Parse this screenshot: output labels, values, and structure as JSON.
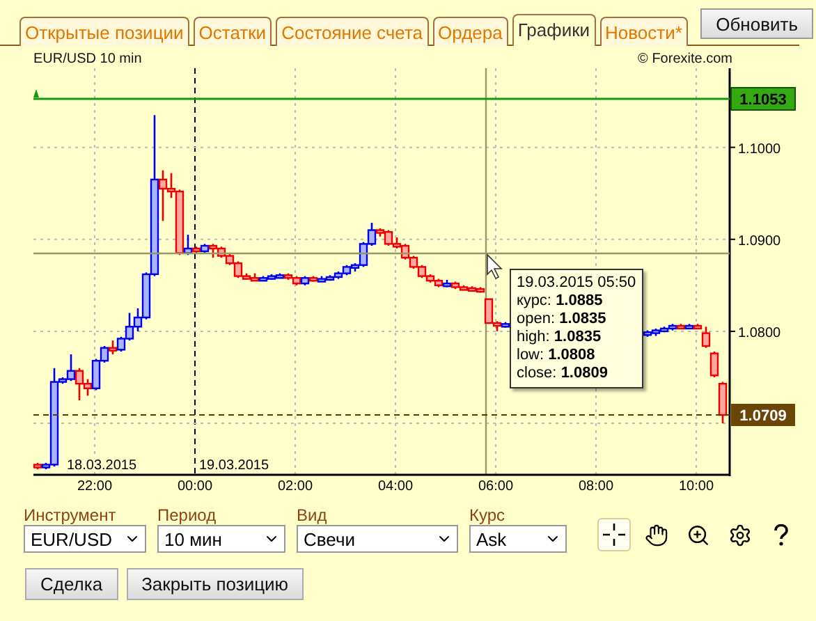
{
  "tabs": [
    {
      "label": "Открытые позиции",
      "selected": false
    },
    {
      "label": "Остатки",
      "selected": false
    },
    {
      "label": "Состояние счета",
      "selected": false
    },
    {
      "label": "Ордера",
      "selected": false
    },
    {
      "label": "Графики",
      "selected": true
    },
    {
      "label": "Новости*",
      "selected": false
    }
  ],
  "refresh_button": "Обновить",
  "chart": {
    "symbol_label": "EUR/USD 10 min",
    "copyright": "© Forexite.com",
    "date_labels": [
      "18.03.2015",
      "19.03.2015"
    ],
    "high_marker": "1.1053",
    "current_price": "1.0709",
    "tooltip": {
      "title": "19.03.2015 05:50",
      "rows": [
        {
          "label": "курс:",
          "value": "1.0885"
        },
        {
          "label": "open:",
          "value": "1.0835"
        },
        {
          "label": "high:",
          "value": "1.0835"
        },
        {
          "label": "low:",
          "value": "1.0808"
        },
        {
          "label": "close:",
          "value": "1.0809"
        }
      ]
    },
    "chart_data": {
      "type": "candlestick",
      "categories": [
        null,
        null,
        null,
        null,
        null,
        null,
        null,
        "22:00",
        null,
        null,
        null,
        null,
        null,
        null,
        null,
        null,
        null,
        null,
        null,
        "00:00",
        null,
        null,
        null,
        null,
        null,
        null,
        null,
        null,
        null,
        null,
        null,
        "02:00",
        null,
        null,
        null,
        null,
        null,
        null,
        null,
        null,
        null,
        null,
        null,
        "04:00",
        null,
        null,
        null,
        null,
        null,
        null,
        null,
        null,
        null,
        null,
        null,
        "06:00",
        null,
        null,
        null,
        null,
        null,
        null,
        null,
        null,
        null,
        null,
        null,
        "08:00",
        null,
        null,
        null,
        null,
        null,
        null,
        null,
        null,
        null,
        null,
        null,
        "10:00",
        null,
        null,
        null
      ],
      "ylim": [
        1.0644,
        1.1086
      ],
      "grid": true,
      "yticks": [
        {
          "value": 1.1,
          "label": "1.1000"
        },
        {
          "value": 1.09,
          "label": "1.0900"
        },
        {
          "value": 1.08,
          "label": "1.0800"
        }
      ],
      "ohlc": [
        [
          1.0655,
          1.0657,
          1.065,
          1.0652
        ],
        [
          1.0652,
          1.0657,
          1.065,
          1.0655
        ],
        [
          1.0655,
          1.076,
          1.0653,
          1.0745
        ],
        [
          1.0745,
          1.075,
          1.0743,
          1.0748
        ],
        [
          1.0748,
          1.0775,
          1.0746,
          1.0757
        ],
        [
          1.0757,
          1.076,
          1.0725,
          1.0743
        ],
        [
          1.0743,
          1.0748,
          1.073,
          1.0738
        ],
        [
          1.0738,
          1.077,
          1.0736,
          1.0768
        ],
        [
          1.0768,
          1.0784,
          1.0766,
          1.0782
        ],
        [
          1.0782,
          1.079,
          1.0775,
          1.078
        ],
        [
          1.078,
          1.0794,
          1.0778,
          1.0792
        ],
        [
          1.0792,
          1.082,
          1.079,
          1.0805
        ],
        [
          1.0805,
          1.0825,
          1.08,
          1.0815
        ],
        [
          1.0815,
          1.0864,
          1.0813,
          1.0862
        ],
        [
          1.0862,
          1.1035,
          1.086,
          1.0965
        ],
        [
          1.0965,
          1.0975,
          1.092,
          1.0955
        ],
        [
          1.0955,
          1.0972,
          1.0945,
          1.0952
        ],
        [
          1.0952,
          1.0954,
          1.0883,
          1.0885
        ],
        [
          1.0885,
          1.0905,
          1.0883,
          1.089
        ],
        [
          1.089,
          1.0892,
          1.0885,
          1.0887
        ],
        [
          1.0887,
          1.0895,
          1.0885,
          1.0893
        ],
        [
          1.0893,
          1.0895,
          1.088,
          1.089
        ],
        [
          1.089,
          1.0892,
          1.088,
          1.0882
        ],
        [
          1.0882,
          1.0884,
          1.0872,
          1.0874
        ],
        [
          1.0874,
          1.0876,
          1.0858,
          1.086
        ],
        [
          1.086,
          1.0863,
          1.0856,
          1.0858
        ],
        [
          1.0858,
          1.0863,
          1.0855,
          1.0857
        ],
        [
          1.0857,
          1.086,
          1.0855,
          1.0858
        ],
        [
          1.0858,
          1.0862,
          1.0856,
          1.086
        ],
        [
          1.086,
          1.0863,
          1.0858,
          1.0861
        ],
        [
          1.0861,
          1.0863,
          1.0856,
          1.0858
        ],
        [
          1.0858,
          1.086,
          1.085,
          1.0852
        ],
        [
          1.0852,
          1.086,
          1.085,
          1.0858
        ],
        [
          1.0858,
          1.086,
          1.0854,
          1.0856
        ],
        [
          1.0856,
          1.086,
          1.0854,
          1.0857
        ],
        [
          1.0857,
          1.0861,
          1.0855,
          1.0859
        ],
        [
          1.0859,
          1.0865,
          1.0857,
          1.0863
        ],
        [
          1.0863,
          1.0872,
          1.0861,
          1.087
        ],
        [
          1.087,
          1.0874,
          1.0865,
          1.0872
        ],
        [
          1.0872,
          1.0897,
          1.087,
          1.0895
        ],
        [
          1.0895,
          1.0918,
          1.0893,
          1.091
        ],
        [
          1.091,
          1.0912,
          1.0903,
          1.0908
        ],
        [
          1.0908,
          1.091,
          1.0893,
          1.0895
        ],
        [
          1.0895,
          1.0902,
          1.089,
          1.0893
        ],
        [
          1.0893,
          1.0895,
          1.0878,
          1.088
        ],
        [
          1.088,
          1.0882,
          1.0868,
          1.087
        ],
        [
          1.087,
          1.0872,
          1.0858,
          1.086
        ],
        [
          1.086,
          1.0862,
          1.0853,
          1.0855
        ],
        [
          1.0855,
          1.0857,
          1.0848,
          1.085
        ],
        [
          1.085,
          1.0856,
          1.0848,
          1.0852
        ],
        [
          1.0852,
          1.0854,
          1.0846,
          1.0848
        ],
        [
          1.0848,
          1.085,
          1.0845,
          1.0847
        ],
        [
          1.0847,
          1.0849,
          1.0844,
          1.0846
        ],
        [
          1.0846,
          1.0848,
          1.0842,
          1.0844
        ],
        [
          1.0835,
          1.0835,
          1.0808,
          1.0809
        ],
        [
          1.0809,
          1.0811,
          1.08,
          1.0806
        ],
        [
          1.0806,
          1.081,
          1.0804,
          1.0808
        ],
        null,
        null,
        null,
        null,
        null,
        null,
        null,
        null,
        null,
        null,
        null,
        null,
        null,
        null,
        null,
        null,
        [
          1.0796,
          1.0801,
          1.0794,
          1.0799
        ],
        [
          1.0799,
          1.0803,
          1.0795,
          1.0801
        ],
        [
          1.0801,
          1.0805,
          1.0799,
          1.0803
        ],
        [
          1.0803,
          1.0808,
          1.0801,
          1.0806
        ],
        [
          1.0806,
          1.0808,
          1.0803,
          1.0805
        ],
        [
          1.0805,
          1.0808,
          1.0803,
          1.0806
        ],
        [
          1.0806,
          1.0808,
          1.0803,
          1.0805
        ],
        [
          1.0798,
          1.0805,
          1.0782,
          1.0784
        ],
        [
          1.0776,
          1.0778,
          1.075,
          1.0752
        ],
        [
          1.0743,
          1.0745,
          1.07,
          1.0709
        ]
      ]
    }
  },
  "controls": [
    {
      "label": "Инструмент",
      "value": "EUR/USD"
    },
    {
      "label": "Период",
      "value": "10 мин"
    },
    {
      "label": "Вид",
      "value": "Свечи"
    },
    {
      "label": "Курс",
      "value": "Ask"
    }
  ],
  "tools": [
    {
      "kind": "crosshair",
      "selected": true
    },
    {
      "kind": "hand",
      "selected": false
    },
    {
      "kind": "zoom",
      "selected": false
    },
    {
      "kind": "settings",
      "selected": false
    },
    {
      "kind": "help",
      "selected": false
    }
  ],
  "buttons": [
    "Сделка",
    "Закрыть позицию"
  ]
}
